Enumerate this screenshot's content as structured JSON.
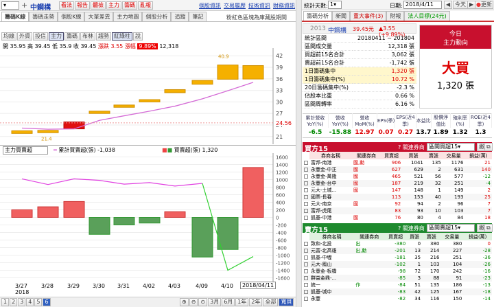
{
  "top": {
    "symbol_select": "",
    "stock_name": "中鋼構",
    "buttons": [
      "看法",
      "報告",
      "體檢",
      "主力",
      "籌碼",
      "亂報"
    ],
    "links": [
      "個股資訊",
      "交易履歷",
      "技術資訊",
      "財務資訊"
    ]
  },
  "tabs_left": [
    "籌碼K線",
    "籌碼走勢",
    "個股K線",
    "大單差異",
    "主力地圖",
    "個股分析",
    "追蹤",
    "筆記"
  ],
  "chart_note": "粉紅色區塊為庫藏股期間",
  "tools": [
    "均線",
    "外資",
    "投信",
    "主力",
    "籌碼",
    "布林",
    "趨勢",
    "紅綠柱",
    "說"
  ],
  "ohlc": {
    "open_label": "開",
    "open": "35.95",
    "high_label": "高",
    "high": "39.45",
    "low_label": "低",
    "low": "35.9",
    "close_label": "收",
    "close": "39.45",
    "chg_label": "漲跌",
    "chg": "3.55",
    "vol_label": "漲幅",
    "vol_pct": "9.89%",
    "vol": "12,318"
  },
  "upper_axis": [
    "42",
    "39",
    "36",
    "33",
    "30",
    "27",
    "24",
    "21"
  ],
  "price_marker": "24.56",
  "annot_cost": "40.9",
  "annot_low": "21.4",
  "lower_panel": {
    "select": "主力買賣超",
    "legend1": "累計買賣超(張) -1,038",
    "legend2": "買賣超(張) 1,320"
  },
  "lower_axis": [
    "1600",
    "1400",
    "1200",
    "1000",
    "800",
    "600",
    "400",
    "200",
    "0",
    "-200",
    "-400",
    "-600",
    "-800",
    "-1000",
    "-1200",
    "-1400",
    "-1600"
  ],
  "dates": [
    "3/27",
    "3/28",
    "3/29",
    "3/30",
    "3/31",
    "4/02",
    "4/03",
    "4/09",
    "4/10"
  ],
  "year": "2018",
  "date_tooltip": "2018/04/11",
  "bottom": {
    "pages": [
      "1",
      "2",
      "3",
      "4",
      "5",
      "6"
    ],
    "ranges": [
      "3月",
      "6月",
      "1年",
      "2年",
      "全部",
      "寬貝"
    ]
  },
  "chart_data": {
    "type": "candlestick+bar",
    "dates": [
      "3/27",
      "3/28",
      "3/29",
      "3/30",
      "3/31",
      "4/02",
      "4/03",
      "4/09",
      "4/10",
      "4/11"
    ],
    "net": [
      200,
      280,
      420,
      -450,
      -200,
      -150,
      150,
      -1050,
      -850,
      1320
    ],
    "cumulative": [
      1020,
      870,
      1020,
      980,
      880,
      920,
      830,
      900,
      -1400,
      -1038
    ]
  },
  "right": {
    "period_label": "統計天數:",
    "period_val": "1",
    "date_label": "日期:",
    "date_val": "2018/4/11",
    "btn_today": "今天",
    "btn_refresh": "更新",
    "tabs": [
      "籌碼分析",
      "新聞",
      "重大事件(3)",
      "財報",
      "法人目標(24元)"
    ],
    "year": "2013",
    "name": "中鋼構",
    "price": "39.45元",
    "chg": "▲3.55 (+9.89%)",
    "stats": [
      [
        "統計區間",
        "20180411 ~ 201804"
      ],
      [
        "區間成交量",
        "12,318 張"
      ],
      [
        "買超前15名合計",
        "3,062 張"
      ],
      [
        "賣超前15名合計",
        "-1,742 張"
      ],
      [
        "1日籌碼集中",
        "1,320 張"
      ],
      [
        "1日籌碼集中(%)",
        "10.72 %"
      ],
      [
        "20日籌碼集中(%)",
        "-2.3 %"
      ],
      [
        "佔股本比重",
        "0.66 %"
      ],
      [
        "區間周轉率",
        "6.16 %"
      ]
    ],
    "today_title": "今日",
    "today_sub": "主力動向",
    "today_big": "大買",
    "today_val": "1,320 張",
    "fin_headers": [
      "累計營收YoY(%)",
      "營收YoY(%)",
      "營收MoM(%)",
      "EPS(季)",
      "EPS(近4季)",
      "本益比",
      "股價淨值比",
      "殖利率(%)",
      "ROE(近4季)"
    ],
    "fin_values": [
      "-6.5",
      "-15.88",
      "12.97",
      "0.07",
      "0.27",
      "13.7",
      "1.89",
      "1.32",
      "1.3"
    ],
    "buy_title": "買方15",
    "sell_title": "賣方15",
    "rel_label": "? 關連券商",
    "rel_select": "區間買超15",
    "rel_select2": "區間賣超15",
    "btn_hide": "撇",
    "cols": [
      "券商名稱",
      "關連券商",
      "買賣超",
      "買張",
      "賣張",
      "交易量",
      "損益(萬)"
    ],
    "buy_rows": [
      [
        "富邦-南港",
        "國,勳",
        "906",
        "1041",
        "135",
        "1176",
        "21"
      ],
      [
        "永豐金-中正",
        "國",
        "627",
        "629",
        "2",
        "631",
        "140"
      ],
      [
        "永豐金-萬隆",
        "國",
        "465",
        "521",
        "56",
        "577",
        "-12"
      ],
      [
        "永豐金-台中",
        "國",
        "187",
        "219",
        "32",
        "251",
        "-4"
      ],
      [
        "元大-土城...",
        "國",
        "147",
        "148",
        "1",
        "149",
        "2"
      ],
      [
        "國票-長春",
        "",
        "113",
        "153",
        "40",
        "193",
        "25"
      ],
      [
        "元大-南京",
        "國",
        "92",
        "94",
        "2",
        "96",
        "7"
      ],
      [
        "富邦-虎尾",
        "",
        "83",
        "93",
        "10",
        "103",
        "7"
      ],
      [
        "凱基-中港",
        "國",
        "76",
        "80",
        "4",
        "84",
        "18"
      ]
    ],
    "sell_rows": [
      [
        "致和-北投",
        "出",
        "-380",
        "0",
        "380",
        "380",
        "0"
      ],
      [
        "元富-北高雄",
        "出,勳",
        "-201",
        "13",
        "214",
        "227",
        "-28"
      ],
      [
        "凱基-中壢",
        "",
        "-181",
        "35",
        "216",
        "251",
        "-36"
      ],
      [
        "元大-鳳山",
        "",
        "-102",
        "1",
        "103",
        "104",
        "-26"
      ],
      [
        "永豐金-板橋",
        "",
        "-98",
        "72",
        "170",
        "242",
        "-16"
      ],
      [
        "群益金鼎-...",
        "",
        "-85",
        "3",
        "88",
        "91",
        "-23"
      ],
      [
        "統一",
        "作",
        "-84",
        "51",
        "135",
        "186",
        "-13"
      ],
      [
        "凱基-城中",
        "",
        "-83",
        "42",
        "125",
        "167",
        "-18"
      ],
      [
        "永豐",
        "",
        "-82",
        "34",
        "116",
        "150",
        "-14"
      ]
    ]
  }
}
